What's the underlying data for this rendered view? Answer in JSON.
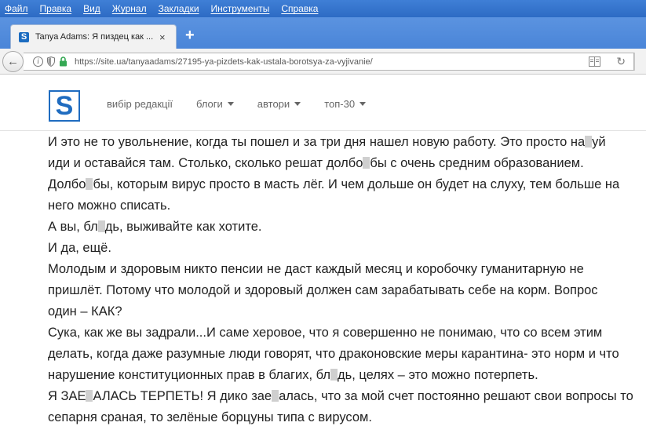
{
  "menubar": {
    "items": [
      "Файл",
      "Правка",
      "Вид",
      "Журнал",
      "Закладки",
      "Инструменты",
      "Справка"
    ]
  },
  "tab": {
    "favicon_letter": "S",
    "title": "Tanya Adams: Я пиздец как ...",
    "close_glyph": "×"
  },
  "newtab_glyph": "+",
  "navbar": {
    "url": "https://site.ua/tanyaadams/27195-ya-pizdets-kak-ustala-borotsya-za-vyjivanie/"
  },
  "site": {
    "logo_letter": "S",
    "nav": [
      {
        "label": "вибір редакції",
        "dropdown": false
      },
      {
        "label": "блоги",
        "dropdown": true
      },
      {
        "label": "автори",
        "dropdown": true
      },
      {
        "label": "топ-30",
        "dropdown": true
      }
    ]
  },
  "article": {
    "lines": [
      [
        "И это не то увольнение, когда ты пошел и за три дня нашел новую работу. Это просто на",
        "#",
        "уй"
      ],
      [
        "иди и оставайся там. Столько, сколько решат долбо",
        "#",
        "бы с очень средним образованием."
      ],
      [
        "Долбо",
        "#",
        "бы, которым вирус просто в масть лёг. И чем дольше он будет на слуху, тем больше на"
      ],
      [
        "него можно списать."
      ],
      [
        "А вы, бл",
        "#",
        "дь, выживайте как хотите."
      ],
      [
        "И да, ещё."
      ],
      [
        "Молодым и здоровым никто пенсии не даст каждый месяц и коробочку гуманитарную не"
      ],
      [
        "пришлёт. Потому что молодой и здоровый должен сам зарабатывать себе на корм. Вопрос"
      ],
      [
        "один – КАК?"
      ],
      [
        "Сука, как же вы задрали...И саме херовое, что я совершенно не понимаю, что со всем этим"
      ],
      [
        "делать, когда даже разумные люди говорят, что драконовские меры карантина- это норм и что"
      ],
      [
        "нарушение конституционных прав в благих, бл",
        "#",
        "дь, целях – это можно потерпеть."
      ],
      [
        "Я ЗАЕ",
        "#",
        "АЛАСЬ ТЕРПЕТЬ! Я дико зае",
        "#",
        "алась, что за мой счет постоянно решают свои вопросы то"
      ],
      [
        "сепарня сраная, то зелёные борцуны типа с вирусом."
      ]
    ]
  }
}
